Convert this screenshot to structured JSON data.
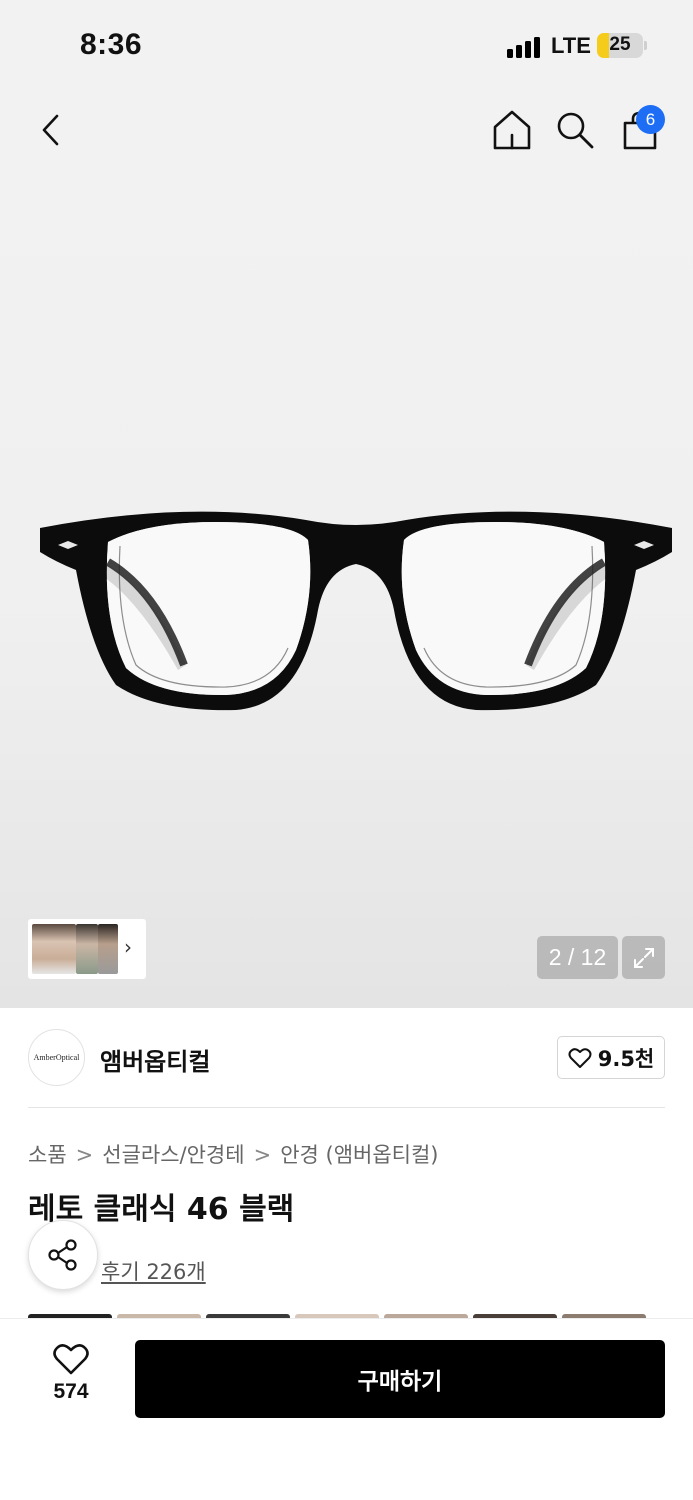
{
  "status_bar": {
    "time": "8:36",
    "network": "LTE",
    "battery": "25",
    "battery_level": 0.25
  },
  "header": {
    "back_icon": "chevron-left-icon",
    "home_icon": "home-icon",
    "search_icon": "search-icon",
    "cart_icon": "shopping-bag-icon",
    "cart_badge": "6",
    "badge_color": "#1e6ef5"
  },
  "gallery": {
    "counter": "2 / 12",
    "current": 2,
    "total": 12,
    "expand_icon": "expand-icon",
    "thumb_arrow": "›"
  },
  "brand": {
    "logo_text": "AmberOptical",
    "name": "앰버옵티컬",
    "like_count": "9.5천",
    "like_icon": "heart-outline-icon"
  },
  "breadcrumb": [
    "소품",
    "선글라스/안경테",
    "안경 (앰버옵티컬)"
  ],
  "breadcrumb_sep": ">",
  "product": {
    "title": "레토 클래식 46 블랙",
    "review_text": "후기 226개"
  },
  "share_icon": "share-icon",
  "bottom": {
    "wish_count": "574",
    "wish_icon": "heart-outline-icon",
    "buy_label": "구매하기",
    "buy_color": "#000000"
  }
}
